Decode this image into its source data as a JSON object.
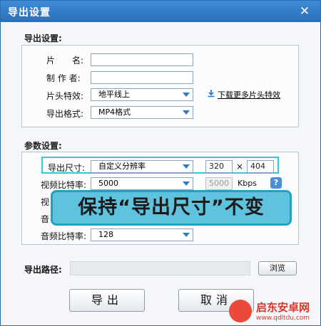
{
  "window": {
    "title": "导出设置",
    "close_glyph": "✕"
  },
  "export_group": {
    "title": "导出设置:",
    "name_label": "片　　名:",
    "name_value": "",
    "author_label": "制 作 者:",
    "author_value": "",
    "intro_effect_label": "片头特效:",
    "intro_effect_value": "地平线上",
    "download_link": "下载更多片头特效",
    "format_label": "导出格式:",
    "format_value": "MP4格式"
  },
  "param_group": {
    "title": "参数设置:",
    "size_label": "导出尺寸:",
    "size_value": "自定义分辨率",
    "width": "320",
    "times": "×",
    "height": "404",
    "video_bitrate_label": "视频比特率:",
    "video_bitrate_value": "5000",
    "video_bitrate_input": "5000",
    "video_bitrate_unit": "Kbps",
    "help_glyph": "?",
    "hidden_label_1": "视",
    "hidden_label_2": "音",
    "audio_bitrate_label": "音频比特率:",
    "audio_bitrate_value": "128"
  },
  "banner": {
    "text": "保持“导出尺寸”不变"
  },
  "path": {
    "label": "导出路径:",
    "value": "",
    "browse": "浏览"
  },
  "buttons": {
    "export": "导出",
    "cancel": "取消"
  },
  "watermark": {
    "cn": "启东安卓网",
    "url": "www.qdltdu.com"
  },
  "colors": {
    "titlebar": "#2a6fbb",
    "highlight": "#37c6e0",
    "banner": "#5fc3de",
    "arrow": "#2f78c8"
  }
}
